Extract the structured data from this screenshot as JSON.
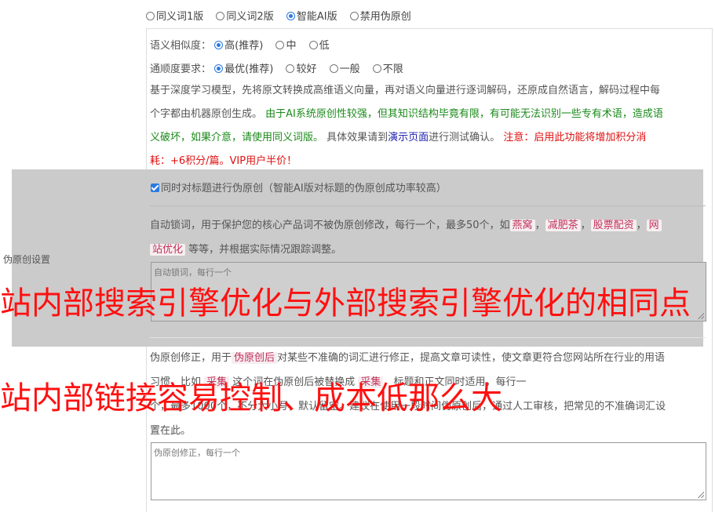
{
  "version_options": [
    {
      "label": "同义词1版",
      "checked": false
    },
    {
      "label": "同义词2版",
      "checked": false
    },
    {
      "label": "智能AI版",
      "checked": true
    },
    {
      "label": "禁用伪原创",
      "checked": false
    }
  ],
  "similarity": {
    "label": "语义相似度：",
    "options": [
      {
        "label": "高(推荐)",
        "checked": true
      },
      {
        "label": "中",
        "checked": false
      },
      {
        "label": "低",
        "checked": false
      }
    ]
  },
  "fluency": {
    "label": "通顺度要求：",
    "options": [
      {
        "label": "最优(推荐)",
        "checked": true
      },
      {
        "label": "较好",
        "checked": false
      },
      {
        "label": "一般",
        "checked": false
      },
      {
        "label": "不限",
        "checked": false
      }
    ]
  },
  "description": {
    "p1": "基于深度学习模型，先将原文转换成高维语义向量，再对语义向量进行逐词解码，还原成自然语言，解码过程中每",
    "p2_start": "个字都由机器原创生成。 ",
    "p2_green": "由于AI系统原创性较强，但其知识结构毕竟有限，有可能无法识别一些专有术语，造成语",
    "p3_green": "义破坏，如果介意，请使用同义词版。",
    "p3_mid": " 具体效果请到",
    "p3_link": "演示页面",
    "p3_after": "进行测试确认。 ",
    "p3_red": "注意：启用此功能将增加积分消",
    "p4_red": "耗：+6积分/篇。VIP用户半价！"
  },
  "title_checkbox": {
    "label": "同时对标题进行伪原创（智能AI版对标题的伪原创成功率较高）",
    "checked": true
  },
  "section_label": "伪原创设置",
  "lock_words": {
    "text_start": "自动锁词，用于保护您的核心产品词不被伪原创修改，每行一个，最多50个，如",
    "keywords": [
      "燕窝",
      "减肥茶",
      "股票配资",
      "网"
    ],
    "line2_kw": "站优化",
    "line2_text": " 等等，并根据实际情况跟踪调整。",
    "placeholder": "自动锁词，每行一个"
  },
  "correction": {
    "line1_start": "伪原创修正，用于",
    "line1_kw": "伪原创后",
    "line1_end": "对某些不准确的词汇进行修正，提高文章可读性，使文章更符合您网站所在行业的用语",
    "line2_start": "习惯，比如 ",
    "line2_kw": "采集",
    "line2_mid": " 这个词在伪原创后被替换成 ",
    "line2_kw2": "采集",
    "line2_end": "，标题和正文同时适用，每行一",
    "line3": "个，最多1000个，不分大小写，默认留空。建议在使用一段时间伪原创后，通过人工审核，把常见的不准确词汇设",
    "line4": "置在此。",
    "placeholder": "伪原创修正，每行一个"
  },
  "banners": {
    "line1": "站内部搜索引擎优化与外部搜索引擎优化的相同点",
    "line2": "站内部链接容易控制、成本低那么大"
  }
}
